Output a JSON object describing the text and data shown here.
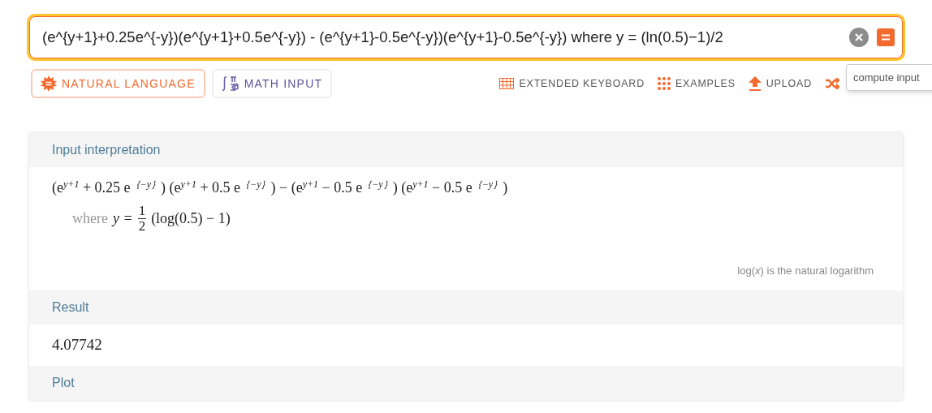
{
  "query": {
    "value": "(e^{y+1}+0.25e^{-y})(e^{y+1}+0.5e^{-y}) - (e^{y+1}-0.5e^{-y})(e^{y+1}-0.5e^{-y}) where y = (ln(0.5)−1)/2",
    "tooltip": "compute input"
  },
  "modes": [
    {
      "label": "NATURAL LANGUAGE",
      "kind": "natural",
      "selected": true
    },
    {
      "label": "MATH INPUT",
      "kind": "math",
      "selected": false
    }
  ],
  "tools": [
    {
      "label": "EXTENDED KEYBOARD",
      "kind": "keyboard"
    },
    {
      "label": "EXAMPLES",
      "kind": "examples"
    },
    {
      "label": "UPLOAD",
      "kind": "upload"
    },
    {
      "kind": "random"
    }
  ],
  "pods": [
    {
      "title": "Input interpretation",
      "kind": "interpretation",
      "formula": "(e$^{y+1}$ + 0.25 e$^{｛−y｝}$) (e$^{y+1}$ + 0.5 e$^{｛−y｝}$) − (e$^{y+1}$ − 0.5 e$^{｛−y｝}$) (e$^{y+1}$ − 0.5 e$^{｛−y｝}$)",
      "where": {
        "word": "where",
        "lhs": "y =",
        "num": "1",
        "den": "2",
        "rhs": "(log(0.5) − 1)"
      },
      "note": "log(*x*) is the natural logarithm"
    },
    {
      "title": "Result",
      "kind": "result",
      "value": "4.07742"
    },
    {
      "title": "Plot",
      "kind": "header"
    }
  ]
}
